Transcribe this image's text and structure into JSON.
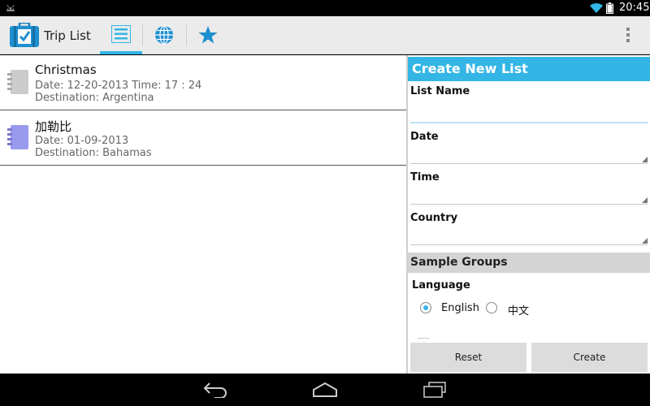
{
  "status_bar": {
    "time": "20:45",
    "left_icon": "android-icon",
    "right_icons": [
      "wifi-icon",
      "battery-icon"
    ]
  },
  "action_bar": {
    "app_icon": "suitcase-check-icon",
    "title": "Trip List",
    "tabs": [
      {
        "icon": "list-icon",
        "selected": true
      },
      {
        "icon": "globe-icon",
        "selected": false
      },
      {
        "icon": "star-icon",
        "selected": false
      }
    ],
    "overflow_icon": "overflow-menu-icon"
  },
  "trips": [
    {
      "name": "Christmas",
      "date_line": "Date: 12-20-2013 Time: 17 : 24",
      "destination_line": "Destination: Argentina",
      "icon_color": "#cccccc"
    },
    {
      "name": "加勒比",
      "date_line": "Date: 01-09-2013",
      "destination_line": "Destination: Bahamas",
      "icon_color": "#9999ee"
    }
  ],
  "form": {
    "header": "Create New List",
    "list_name": {
      "label": "List Name",
      "value": ""
    },
    "date": {
      "label": "Date",
      "value": ""
    },
    "time": {
      "label": "Time",
      "value": ""
    },
    "country": {
      "label": "Country",
      "value": ""
    },
    "groups_header": "Sample Groups",
    "language": {
      "label": "Language",
      "options": [
        {
          "label": "English",
          "selected": true
        },
        {
          "label": "中文",
          "selected": false
        }
      ]
    },
    "reset_label": "Reset",
    "create_label": "Create"
  },
  "nav_bar": {
    "buttons": [
      "back-icon",
      "home-icon",
      "recent-apps-icon"
    ]
  },
  "colors": {
    "accent": "#33b5e5",
    "action_bar_bg": "#ebebeb",
    "section_bg": "#d4d4d4"
  }
}
